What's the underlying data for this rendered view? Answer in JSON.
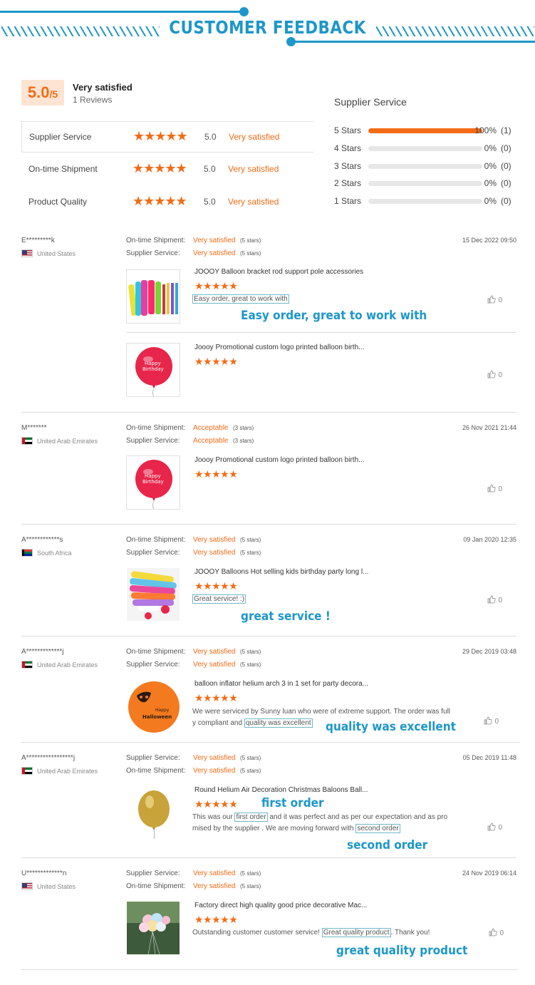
{
  "header": {
    "title": "CUSTOMER FEEDBACK"
  },
  "summary": {
    "score": "5.0",
    "score_suffix": "/5",
    "label": "Very satisfied",
    "reviews": "1 Reviews",
    "ratings": [
      {
        "label": "Supplier Service",
        "stars": 5,
        "value": "5.0",
        "text": "Very satisfied"
      },
      {
        "label": "On-time Shipment",
        "stars": 5,
        "value": "5.0",
        "text": "Very satisfied"
      },
      {
        "label": "Product Quality",
        "stars": 5,
        "value": "5.0",
        "text": "Very satisfied"
      }
    ],
    "distribution_title": "Supplier Service",
    "distribution": [
      {
        "label": "5 Stars",
        "percent": 100,
        "pct_text": "100%",
        "count": "(1)"
      },
      {
        "label": "4 Stars",
        "percent": 0,
        "pct_text": "0%",
        "count": "(0)"
      },
      {
        "label": "3 Stars",
        "percent": 0,
        "pct_text": "0%",
        "count": "(0)"
      },
      {
        "label": "2 Stars",
        "percent": 0,
        "pct_text": "0%",
        "count": "(0)"
      },
      {
        "label": "1 Stars",
        "percent": 0,
        "pct_text": "0%",
        "count": "(0)"
      }
    ]
  },
  "colors": {
    "accent": "#f36b16",
    "brand_blue": "#1d97c9"
  },
  "reviews": [
    {
      "reviewer": "E*********k",
      "country": "United States",
      "flag": "us",
      "date": "15 Dec 2022 09:50",
      "meta": [
        {
          "label": "On-time Shipment:",
          "value": "Very satisfied",
          "stars": "(5 stars)"
        },
        {
          "label": "Supplier Service:",
          "value": "Very satisfied",
          "stars": "(5 stars)"
        }
      ],
      "products": [
        {
          "title": "JOOOY Balloon bracket rod support pole accessories",
          "stars": "★★★★★",
          "comment": "Easy order, great to work with",
          "likes": "0",
          "annotation": "Easy order, great to work with"
        },
        {
          "title": "Joooy Promotional custom logo printed balloon birth...",
          "stars": "★★★★★",
          "comment": "",
          "likes": "0"
        }
      ]
    },
    {
      "reviewer": "M*******",
      "country": "United Arab Emirates",
      "flag": "ae",
      "date": "26 Nov 2021 21:44",
      "meta": [
        {
          "label": "On-time Shipment:",
          "value": "Acceptable",
          "stars": "(3 stars)"
        },
        {
          "label": "Supplier Service:",
          "value": "Acceptable",
          "stars": "(3 stars)"
        }
      ],
      "products": [
        {
          "title": "Joooy Promotional custom logo printed balloon birth...",
          "stars": "★★★★★",
          "comment": "",
          "likes": "0"
        }
      ]
    },
    {
      "reviewer": "A************s",
      "country": "South Africa",
      "flag": "za",
      "date": "09 Jan 2020 12:35",
      "meta": [
        {
          "label": "On-time Shipment:",
          "value": "Very satisfied",
          "stars": "(5 stars)"
        },
        {
          "label": "Supplier Service:",
          "value": "Very satisfied",
          "stars": "(5 stars)"
        }
      ],
      "products": [
        {
          "title": "JOOOY Balloons Hot selling kids birthday party long l...",
          "stars": "★★★★★",
          "comment": "Great service! :)",
          "likes": "0",
          "annotation": "great service !"
        }
      ]
    },
    {
      "reviewer": "A*************j",
      "country": "United Arab Emirates",
      "flag": "ae",
      "date": "29 Dec 2019 03:48",
      "meta": [
        {
          "label": "On-time Shipment:",
          "value": "Very satisfied",
          "stars": "(5 stars)"
        },
        {
          "label": "Supplier Service:",
          "value": "Very satisfied",
          "stars": "(5 stars)"
        }
      ],
      "products": [
        {
          "title": "balloon inflator helium arch 3 in 1 set for party decora...",
          "stars": "★★★★★",
          "comment_a": "We were serviced by Sunny luan who were of extreme support. The order was full",
          "comment_b": "y compliant and ",
          "comment_hl": "quality was excellent",
          "likes": "0",
          "annotation": "quality was excellent"
        }
      ]
    },
    {
      "reviewer": "A*****************j",
      "country": "United Arab Emirates",
      "flag": "ae",
      "date": "05 Dec 2019 11:48",
      "meta": [
        {
          "label": "Supplier Service:",
          "value": "Very satisfied",
          "stars": "(5 stars)"
        },
        {
          "label": "On-time Shipment:",
          "value": "Very satisfied",
          "stars": "(5 stars)"
        }
      ],
      "products": [
        {
          "title": "Round Helium Air Decoration Christmas Baloons Ball...",
          "stars": "★★★★★",
          "c1": "This was our ",
          "c1_hl": "first order",
          "c1_rest": " and it was perfect and as per our expectation and as pro",
          "c2": "mised by the supplier . We are moving forward with ",
          "c2_hl": "second order",
          "likes": "0",
          "annotation_a": "first order",
          "annotation_b": "second order"
        }
      ]
    },
    {
      "reviewer": "U*************n",
      "country": "United States",
      "flag": "us",
      "date": "24 Nov 2019 06:14",
      "meta": [
        {
          "label": "Supplier Service:",
          "value": "Very satisfied",
          "stars": "(5 stars)"
        },
        {
          "label": "On-time Shipment:",
          "value": "Very satisfied",
          "stars": "(5 stars)"
        }
      ],
      "products": [
        {
          "title": "Factory direct high quality good price decorative Mac...",
          "stars": "★★★★★",
          "c_pre": "Outstanding customer customer service! ",
          "c_hl": "Great quality product",
          "c_post": ". Thank you!",
          "likes": "0",
          "annotation": "great quality product"
        }
      ]
    }
  ]
}
